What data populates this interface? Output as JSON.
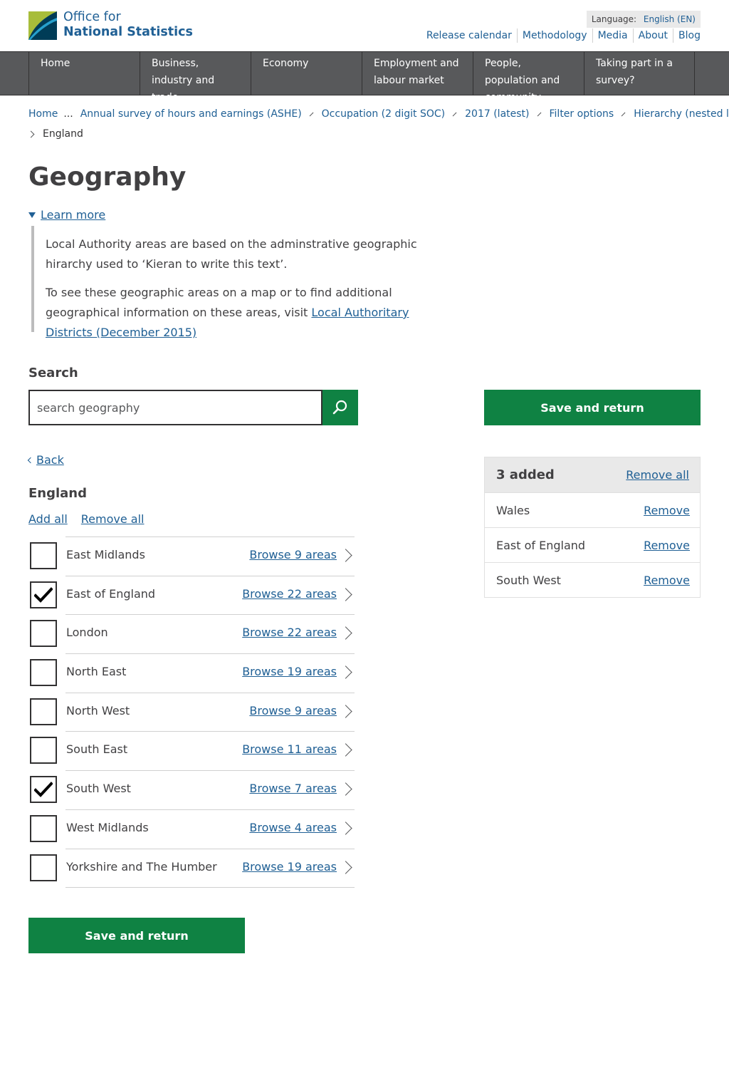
{
  "header": {
    "logo_line1": "Office for",
    "logo_line2": "National Statistics",
    "language_label": "Language:",
    "language_value": "English (EN)",
    "links": [
      "Release calendar",
      "Methodology",
      "Media",
      "About",
      "Blog"
    ]
  },
  "nav": {
    "items": [
      "Home",
      "Business, industry and trade",
      "Economy",
      "Employment and labour market",
      "People, population and community",
      "Taking part in a survey?"
    ]
  },
  "breadcrumb": {
    "home": "Home",
    "ellipsis": "...",
    "items": [
      "Annual survey of hours and earnings (ASHE)",
      "Occupation (2 digit SOC)",
      "2017 (latest)",
      "Filter options",
      "Hierarchy (nested list)"
    ],
    "current": "England"
  },
  "page_title": "Geography",
  "learn_more": {
    "label": "Learn more",
    "para1": "Local Authority areas are based on the adminstrative geographic hirarchy used to ‘Kieran to write this text’.",
    "para2_prefix": "To see these geographic areas on a map or to find additional geographical information on these areas, visit ",
    "para2_link": "Local Authoritary Districts (December 2015)"
  },
  "search": {
    "label": "Search",
    "placeholder": "search geography",
    "icon": "search-icon"
  },
  "save_label": "Save and return",
  "back_label": "Back",
  "region": {
    "title": "England",
    "add_all": "Add all",
    "remove_all": "Remove all",
    "items": [
      {
        "name": "East Midlands",
        "browse": "Browse 9 areas",
        "checked": false
      },
      {
        "name": "East of England",
        "browse": "Browse 22 areas",
        "checked": true
      },
      {
        "name": "London",
        "browse": "Browse 22 areas",
        "checked": false
      },
      {
        "name": "North East",
        "browse": "Browse 19 areas",
        "checked": false
      },
      {
        "name": "North West",
        "browse": "Browse 9 areas",
        "checked": false
      },
      {
        "name": "South East",
        "browse": "Browse 11 areas",
        "checked": false
      },
      {
        "name": "South West",
        "browse": "Browse 7 areas",
        "checked": true
      },
      {
        "name": "West Midlands",
        "browse": "Browse 4 areas",
        "checked": false
      },
      {
        "name": "Yorkshire and The Humber",
        "browse": "Browse 19 areas",
        "checked": false
      }
    ]
  },
  "added": {
    "count_label": "3 added",
    "remove_all": "Remove all",
    "remove_label": "Remove",
    "items": [
      "Wales",
      "East of England",
      "South West"
    ]
  },
  "colors": {
    "link": "#206095",
    "green": "#0f8243",
    "nav_bg": "#58595b"
  }
}
